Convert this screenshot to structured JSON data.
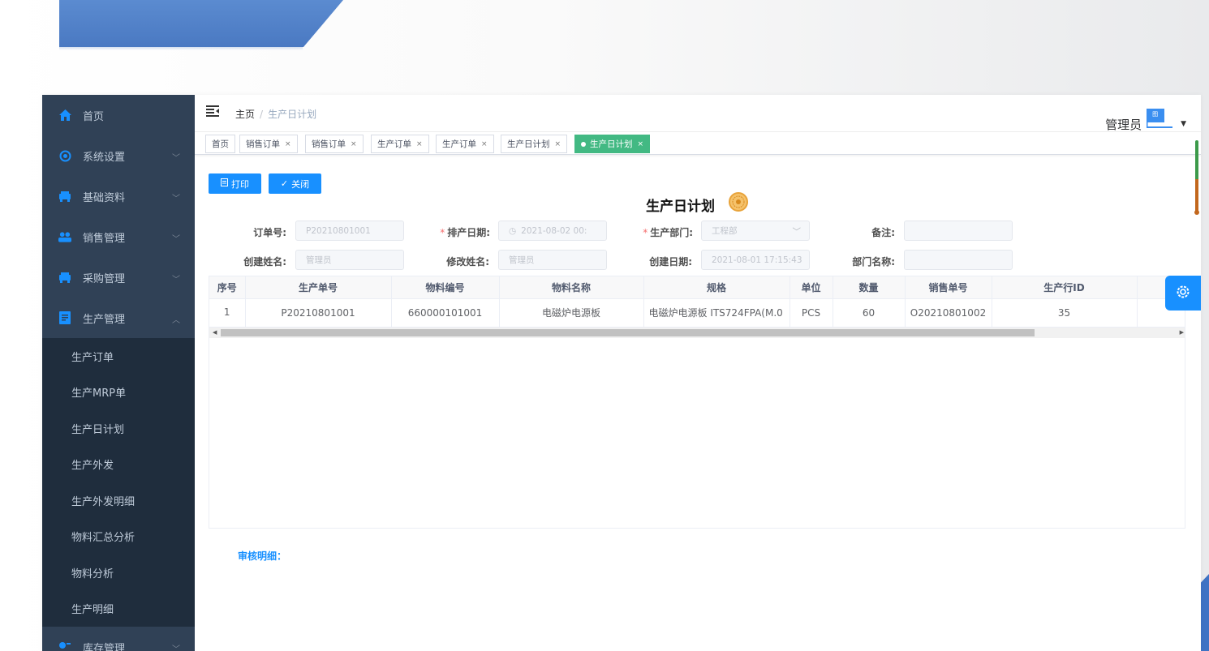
{
  "sidebar": {
    "items": [
      {
        "label": "首页",
        "icon": "home-icon",
        "has_arrow": false
      },
      {
        "label": "系统设置",
        "icon": "system-icon",
        "has_arrow": true
      },
      {
        "label": "基础资料",
        "icon": "car-icon",
        "has_arrow": true
      },
      {
        "label": "销售管理",
        "icon": "users-icon",
        "has_arrow": true
      },
      {
        "label": "采购管理",
        "icon": "car-icon",
        "has_arrow": true
      },
      {
        "label": "生产管理",
        "icon": "document-icon",
        "has_arrow": true,
        "expanded": true
      }
    ],
    "submenu": [
      "生产订单",
      "生产MRP单",
      "生产日计划",
      "生产外发",
      "生产外发明细",
      "物料汇总分析",
      "物料分析",
      "生产明细"
    ],
    "last_item": {
      "label": "库存管理",
      "icon": "inventory-icon"
    }
  },
  "breadcrumb": {
    "home": "主页",
    "separator": "/",
    "current": "生产日计划"
  },
  "user": {
    "name": "管理员",
    "avatar_text": "图"
  },
  "tags": [
    {
      "label": "首页",
      "closable": false,
      "active": false
    },
    {
      "label": "销售订单",
      "closable": true,
      "active": false
    },
    {
      "label": "销售订单",
      "closable": true,
      "active": false
    },
    {
      "label": "生产订单",
      "closable": true,
      "active": false
    },
    {
      "label": "生产订单",
      "closable": true,
      "active": false
    },
    {
      "label": "生产日计划",
      "closable": true,
      "active": false
    },
    {
      "label": "生产日计划",
      "closable": true,
      "active": true
    }
  ],
  "tag_close": "×",
  "toolbar": {
    "print_label": "打印",
    "close_label": "关闭"
  },
  "page_title": "生产日计划",
  "form": {
    "order_no": {
      "label": "订单号:",
      "value": "P20210801001"
    },
    "schedule_date": {
      "label": "排产日期:",
      "value": "2021-08-02 00:",
      "required": true
    },
    "dept": {
      "label": "生产部门:",
      "value": "工程部",
      "required": true
    },
    "remark": {
      "label": "备注:",
      "value": ""
    },
    "creator": {
      "label": "创建姓名:",
      "value": "管理员"
    },
    "modifier": {
      "label": "修改姓名:",
      "value": "管理员"
    },
    "create_date": {
      "label": "创建日期:",
      "value": "2021-08-01 17:15:43"
    },
    "dept_name": {
      "label": "部门名称:",
      "value": ""
    }
  },
  "table": {
    "columns": [
      "序号",
      "生产单号",
      "物料编号",
      "物料名称",
      "规格",
      "单位",
      "数量",
      "销售单号",
      "生产行ID"
    ],
    "rows": [
      [
        "1",
        "P20210801001",
        "660000101001",
        "电磁炉电源板",
        "电磁炉电源板 ITS724FPA(M.0",
        "PCS",
        "60",
        "O20210801002",
        "35"
      ]
    ]
  },
  "audit_label": "审核明细：",
  "colors": {
    "sidebar_bg": "#304156",
    "submenu_bg": "#1f2d3d",
    "primary": "#1890ff",
    "tag_active": "#42b983"
  }
}
